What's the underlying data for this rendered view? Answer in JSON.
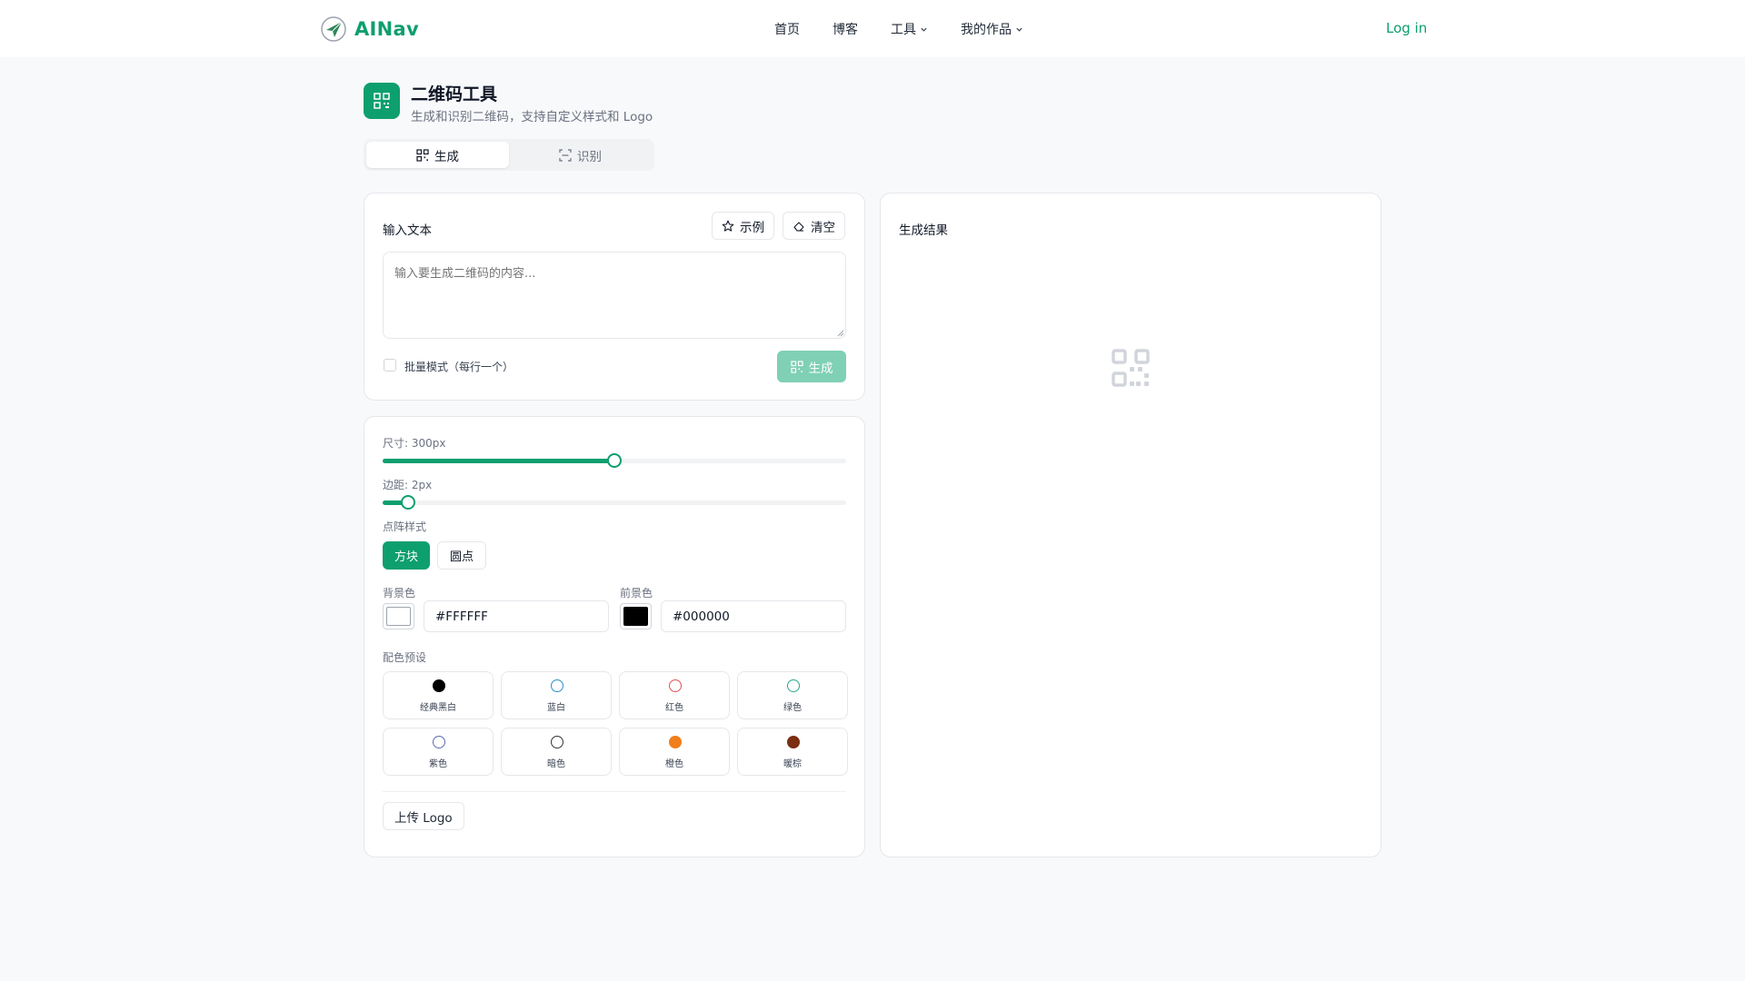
{
  "header": {
    "brand": "AINav",
    "nav": [
      {
        "label": "首页",
        "has_dropdown": false
      },
      {
        "label": "博客",
        "has_dropdown": false
      },
      {
        "label": "工具",
        "has_dropdown": true
      },
      {
        "label": "我的作品",
        "has_dropdown": true
      }
    ],
    "login": "Log in"
  },
  "tool": {
    "title": "二维码工具",
    "subtitle": "生成和识别二维码，支持自定义样式和 Logo",
    "tabs": [
      {
        "label": "生成",
        "active": true,
        "icon": "qr-code-icon"
      },
      {
        "label": "识别",
        "active": false,
        "icon": "scan-icon"
      }
    ]
  },
  "input_card": {
    "title": "输入文本",
    "example_button": "示例",
    "clear_button": "清空",
    "placeholder": "输入要生成二维码的内容...",
    "batch_label": "批量模式（每行一个）",
    "batch_checked": false,
    "generate_button": "生成"
  },
  "settings": {
    "size_label": "尺寸: 300px",
    "size_fraction": 0.5,
    "margin_label": "边距: 2px",
    "margin_fraction": 0.055,
    "dot_style_label": "点阵样式",
    "dot_styles": [
      {
        "label": "方块",
        "active": true
      },
      {
        "label": "圆点",
        "active": false
      }
    ],
    "bg_label": "背景色",
    "bg_value": "#FFFFFF",
    "fg_label": "前景色",
    "fg_value": "#000000",
    "presets_label": "配色预设",
    "presets": [
      {
        "name": "经典黑白",
        "fill": "#000000",
        "border": "#000000",
        "filled": true
      },
      {
        "name": "蓝白",
        "fill": "#ffffff",
        "border": "#2b8fc9",
        "filled": false
      },
      {
        "name": "红色",
        "fill": "#ffffff",
        "border": "#e05252",
        "filled": false
      },
      {
        "name": "绿色",
        "fill": "#ffffff",
        "border": "#2aa58b",
        "filled": false
      },
      {
        "name": "紫色",
        "fill": "#ffffff",
        "border": "#5b6bb5",
        "filled": false
      },
      {
        "name": "暗色",
        "fill": "#ffffff",
        "border": "#333333",
        "filled": false
      },
      {
        "name": "橙色",
        "fill": "#f07e1b",
        "border": "#f07e1b",
        "filled": true
      },
      {
        "name": "暖棕",
        "fill": "#7a2e12",
        "border": "#7a2e12",
        "filled": true
      }
    ],
    "upload_logo": "上传 Logo"
  },
  "result_card": {
    "title": "生成结果"
  },
  "colors": {
    "accent": "#0e9f6e",
    "accent_disabled": "#7fd0b4"
  }
}
